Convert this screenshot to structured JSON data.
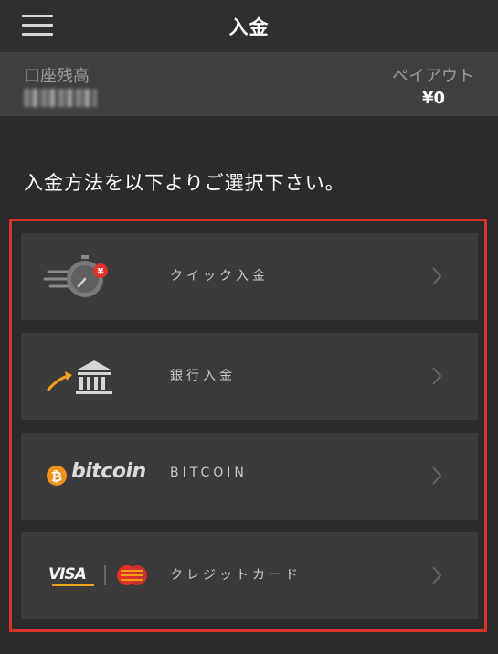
{
  "header": {
    "title": "入金",
    "menu_icon": "hamburger-menu-icon"
  },
  "balance": {
    "label": "口座残高",
    "payout_label": "ペイアウト",
    "payout_value": "¥0"
  },
  "instruction": "入金方法を以下よりご選択下さい。",
  "methods": [
    {
      "label": "クイック入金",
      "icon": "quick-deposit-icon"
    },
    {
      "label": "銀行入金",
      "icon": "bank-icon"
    },
    {
      "label": "BITCOIN",
      "icon": "bitcoin-logo",
      "logo_text": "bitcoin"
    },
    {
      "label": "クレジットカード",
      "icon": "credit-card-logos",
      "logo_text": "VISA"
    }
  ],
  "colors": {
    "highlight_border": "#d9342b",
    "bitcoin_orange": "#f0921a",
    "accent_red": "#e0322a"
  }
}
